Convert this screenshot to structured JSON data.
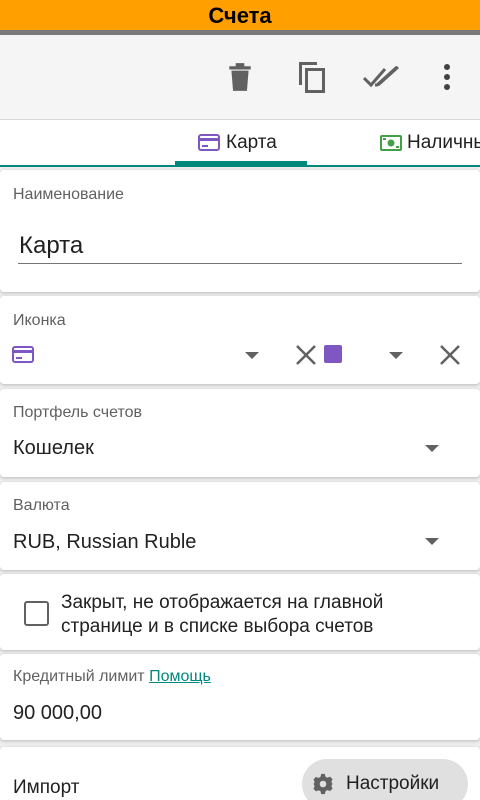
{
  "title": "Счета",
  "toolbar": {
    "delete": "delete-icon",
    "copy": "copy-icon",
    "done_all": "done-all-icon",
    "more": "more-vert-icon"
  },
  "tabs": [
    {
      "label": "Карта",
      "icon": "credit-card-icon",
      "active": true
    },
    {
      "label": "Наличные",
      "icon": "cash-icon",
      "active": false
    }
  ],
  "name_field": {
    "label": "Наименование",
    "value": "Карта"
  },
  "icon_field": {
    "label": "Иконка",
    "icon": "credit-card-icon",
    "color": "#7e57c2"
  },
  "portfolio_field": {
    "label": "Портфель счетов",
    "value": "Кошелек"
  },
  "currency_field": {
    "label": "Валюта",
    "value": "RUB, Russian Ruble"
  },
  "closed_checkbox": {
    "line1": "Закрыт, не отображается на главной",
    "line2": "странице и в списке выбора счетов",
    "checked": false
  },
  "credit_limit": {
    "label": "Кредитный лимит",
    "help": "Помощь",
    "value": "90 000,00"
  },
  "import": {
    "label": "Импорт",
    "settings": "Настройки"
  },
  "colors": {
    "accent": "#00897b",
    "header": "#ffa000",
    "icon_purple": "#7e57c2"
  }
}
